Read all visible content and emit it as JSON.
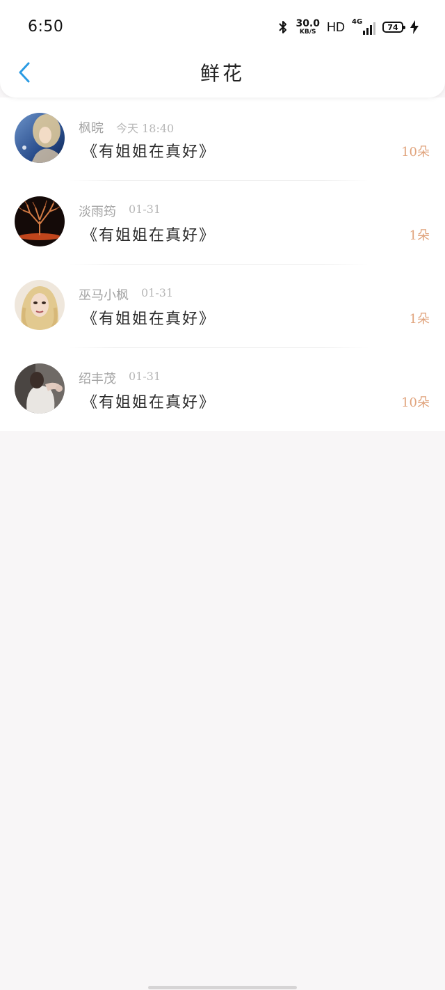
{
  "status_bar": {
    "time": "6:50",
    "net_speed": "30.0",
    "net_speed_unit": "KB/S",
    "hd": "HD",
    "network": "4G",
    "battery": "74"
  },
  "nav": {
    "title": "鲜花"
  },
  "colors": {
    "accent": "#2a9be3",
    "count": "#e0a37c"
  },
  "flowers": [
    {
      "name": "枫晥",
      "time": "今天 18:40",
      "message": "《有姐姐在真好》",
      "count": "10朵"
    },
    {
      "name": "淡雨筠",
      "time": "01-31",
      "message": "《有姐姐在真好》",
      "count": "1朵"
    },
    {
      "name": "巫马小枫",
      "time": "01-31",
      "message": "《有姐姐在真好》",
      "count": "1朵"
    },
    {
      "name": "绍丰茂",
      "time": "01-31",
      "message": "《有姐姐在真好》",
      "count": "10朵"
    }
  ]
}
